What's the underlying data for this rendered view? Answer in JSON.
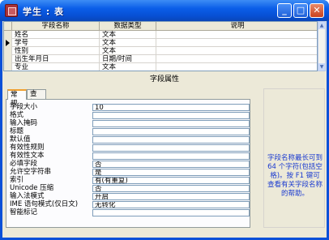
{
  "window": {
    "title": "学生 : 表"
  },
  "title_buttons": {
    "minimize": "_",
    "maximize": "□",
    "close": "✕"
  },
  "grid": {
    "headers": {
      "name": "字段名称",
      "type": "数据类型",
      "desc": "说明"
    },
    "rows": [
      {
        "name": "姓名",
        "type": "文本",
        "desc": ""
      },
      {
        "name": "学号",
        "type": "文本",
        "desc": ""
      },
      {
        "name": "性别",
        "type": "文本",
        "desc": ""
      },
      {
        "name": "出生年月日",
        "type": "日期/时间",
        "desc": ""
      },
      {
        "name": "专业",
        "type": "文本",
        "desc": ""
      }
    ]
  },
  "properties_label": "字段属性",
  "tabs": {
    "general": "常规",
    "lookup": "查阅"
  },
  "properties": [
    {
      "name": "字段大小",
      "value": "10"
    },
    {
      "name": "格式",
      "value": ""
    },
    {
      "name": "输入掩码",
      "value": ""
    },
    {
      "name": "标题",
      "value": ""
    },
    {
      "name": "默认值",
      "value": ""
    },
    {
      "name": "有效性规则",
      "value": ""
    },
    {
      "name": "有效性文本",
      "value": ""
    },
    {
      "name": "必填字段",
      "value": "否"
    },
    {
      "name": "允许空字符串",
      "value": "是"
    },
    {
      "name": "索引",
      "value": "有(有重复)"
    },
    {
      "name": "Unicode 压缩",
      "value": "否"
    },
    {
      "name": "输入法模式",
      "value": "开启"
    },
    {
      "name": "IME 语句模式(仅日文)",
      "value": "无转化"
    },
    {
      "name": "智能标记",
      "value": ""
    }
  ],
  "help_text": "字段名称最长可到 64 个字符(包括空格)。按 F1 键可查看有关字段名称的帮助。",
  "colors": {
    "title_bar": "#0b5ee8",
    "help_text": "#1a3ad0",
    "client_bg": "#ece9d8"
  }
}
